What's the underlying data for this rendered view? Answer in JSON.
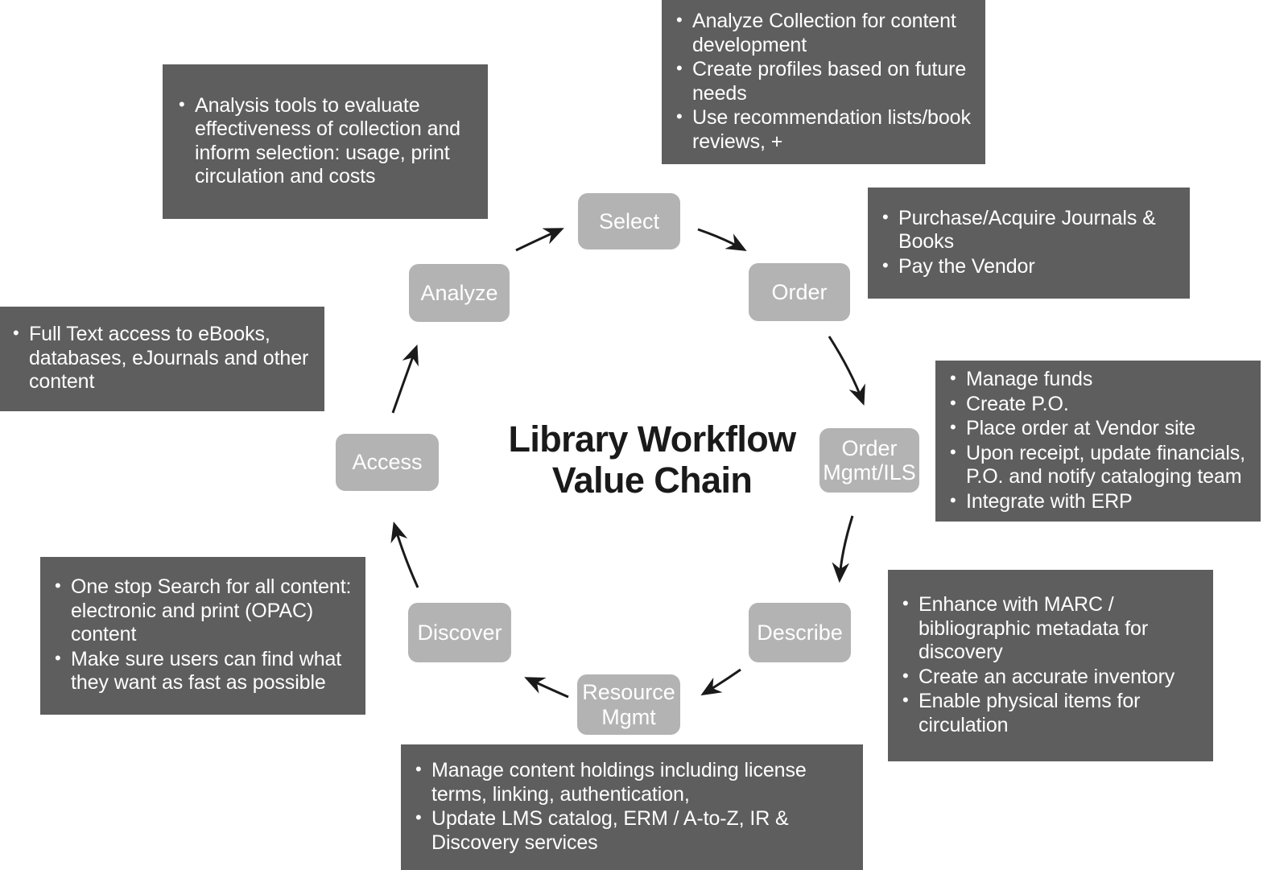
{
  "diagram": {
    "title_line1": "Library Workflow",
    "title_line2": "Value Chain",
    "colors": {
      "callout_bg": "#5e5e5e",
      "node_bg": "#b3b3b3",
      "text_on_dark": "#ffffff",
      "title_color": "#1a1a1a",
      "arrow_color": "#1a1a1a",
      "page_bg": "#ffffff"
    }
  },
  "nodes": [
    {
      "id": "select",
      "label": "Select"
    },
    {
      "id": "order",
      "label": "Order"
    },
    {
      "id": "order-mgmt-ils",
      "label": "Order\nMgmt/ILS"
    },
    {
      "id": "describe",
      "label": "Describe"
    },
    {
      "id": "resource-mgmt",
      "label": "Resource\nMgmt"
    },
    {
      "id": "discover",
      "label": "Discover"
    },
    {
      "id": "access",
      "label": "Access"
    },
    {
      "id": "analyze",
      "label": "Analyze"
    }
  ],
  "node_labels": {
    "select": "Select",
    "order": "Order",
    "order_mgmt_ils_line1": "Order",
    "order_mgmt_ils_line2": "Mgmt/ILS",
    "describe": "Describe",
    "resource_mgmt_line1": "Resource",
    "resource_mgmt_line2": "Mgmt",
    "discover": "Discover",
    "access": "Access",
    "analyze": "Analyze"
  },
  "callouts": {
    "select_top_right": {
      "related_node": "Select",
      "bullets": [
        "Analyze Collection for content development",
        "Create profiles based on future needs",
        "Use recommendation lists/book reviews, +"
      ]
    },
    "analyze_top_left": {
      "related_node": "Analyze",
      "bullets": [
        "Analysis tools to evaluate effectiveness of collection and inform selection:  usage, print circulation and costs"
      ]
    },
    "order_right": {
      "related_node": "Order",
      "bullets": [
        "Purchase/Acquire Journals & Books",
        "Pay the Vendor"
      ]
    },
    "order_mgmt_right": {
      "related_node": "Order Mgmt/ILS",
      "bullets": [
        "Manage funds",
        "Create P.O.",
        "Place order at Vendor site",
        "Upon receipt, update financials, P.O. and notify cataloging team",
        "Integrate with ERP"
      ]
    },
    "describe_bottom_right": {
      "related_node": "Describe",
      "bullets": [
        "Enhance with MARC / bibliographic metadata for discovery",
        "Create an accurate inventory",
        "Enable physical items for circulation"
      ]
    },
    "resource_mgmt_bottom": {
      "related_node": "Resource Mgmt",
      "bullets": [
        "Manage content holdings including license terms, linking, authentication,",
        "Update LMS catalog, ERM / A-to-Z, IR & Discovery services"
      ]
    },
    "discover_bottom_left": {
      "related_node": "Discover",
      "bullets": [
        "One stop Search for all content: electronic and print (OPAC) content",
        "Make sure users can find what they want as fast as possible"
      ]
    },
    "access_left": {
      "related_node": "Access",
      "bullets": [
        "Full Text access to eBooks, databases, eJournals and other content"
      ]
    }
  }
}
